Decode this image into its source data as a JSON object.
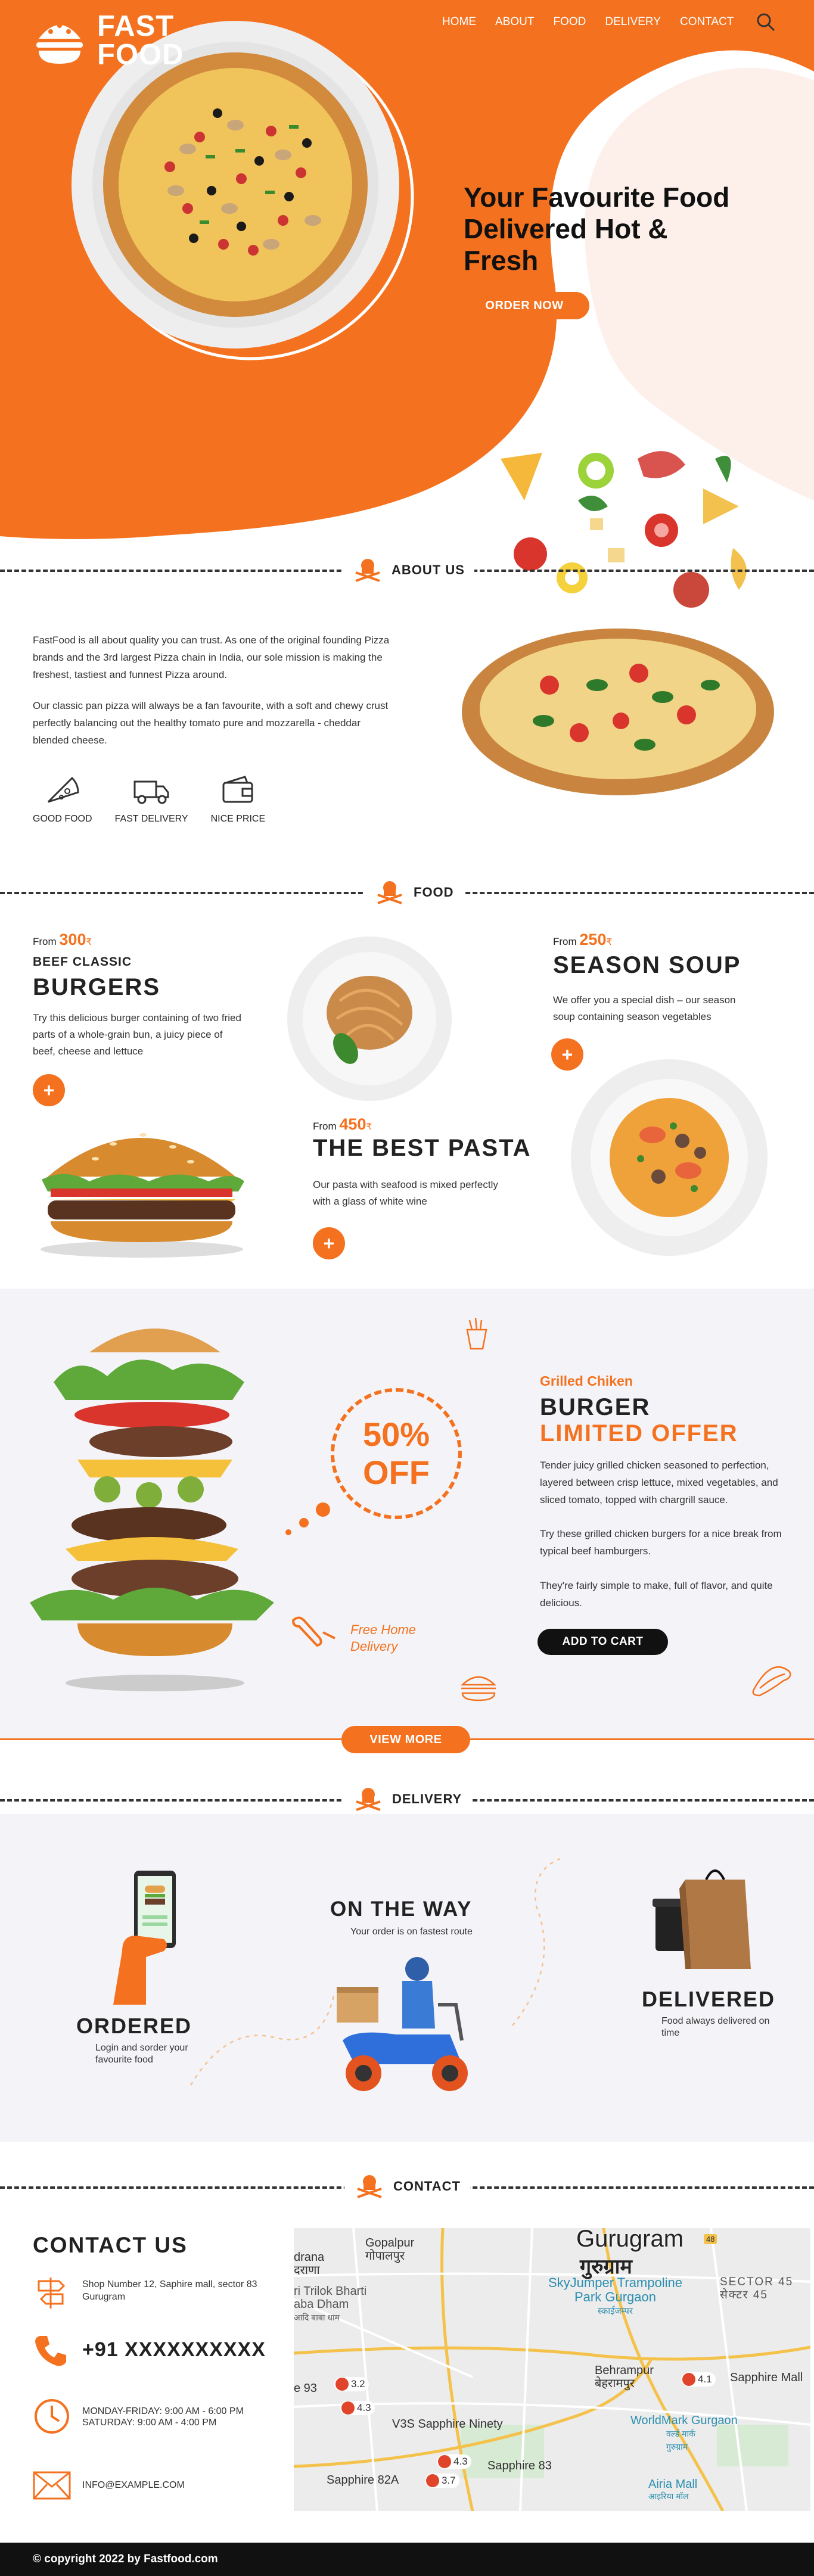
{
  "brand": {
    "line1": "FAST",
    "line2": "FOOD",
    "logo": "pizza-burger-logo-icon"
  },
  "nav": [
    {
      "label": "HOME"
    },
    {
      "label": "ABOUT"
    },
    {
      "label": "FOOD"
    },
    {
      "label": "DELIVERY"
    },
    {
      "label": "CONTACT"
    }
  ],
  "hero": {
    "title1": "Your Favourite Food",
    "title2": "Delivered Hot &",
    "title3": "Fresh",
    "cta": "ORDER NOW"
  },
  "about": {
    "tag": "ABOUT US",
    "p1": "FastFood is all about quality you can trust. As one of the original founding Pizza brands and the 3rd largest Pizza chain in India, our sole mission is making the freshest, tastiest and funnest Pizza around.",
    "p2": "Our classic pan pizza will always be a fan favourite, with a soft and chewy crust perfectly balancing out the healthy tomato pure and mozzarella - cheddar blended cheese.",
    "features": [
      {
        "label": "GOOD FOOD",
        "icon": "pizza-slice-icon"
      },
      {
        "label": "FAST DELIVERY",
        "icon": "truck-icon"
      },
      {
        "label": "NICE PRICE",
        "icon": "wallet-icon"
      }
    ]
  },
  "food": {
    "tag": "FOOD",
    "burgers": {
      "from": "From",
      "price": "300",
      "currency": "₹",
      "sub": "BEEF CLASSIC",
      "title": "BURGERS",
      "desc": "Try this delicious burger containing of two fried parts of a whole-grain bun, a juicy piece of beef, cheese and lettuce"
    },
    "soup": {
      "from": "From",
      "price": "250",
      "currency": "₹",
      "title": "SEASON SOUP",
      "desc": "We offer you a special dish – our season soup containing season vegetables"
    },
    "pasta": {
      "from": "From",
      "price": "450",
      "currency": "₹",
      "title": "THE BEST PASTA",
      "desc": "Our pasta with seafood is mixed perfectly with a glass of white wine"
    }
  },
  "offer": {
    "badge1": "50%",
    "badge2": "OFF",
    "delivery1": "Free Home",
    "delivery2": "Delivery",
    "kicker": "Grilled Chiken",
    "title": "BURGER",
    "subtitle": "LIMITED OFFER",
    "p1": "Tender juicy grilled chicken seasoned to perfection, layered between crisp lettuce, mixed vegetables, and sliced tomato, topped with chargrill sauce.",
    "p2": "Try these grilled chicken burgers for a nice break from typical beef hamburgers.",
    "p3": "They're fairly simple to make, full of flavor, and quite delicious.",
    "cart": "ADD TO CART",
    "more": "VIEW MORE"
  },
  "delivery": {
    "tag": "DELIVERY",
    "ordered": {
      "title": "ORDERED",
      "desc": "Login and sorder your favourite food"
    },
    "way": {
      "title": "ON THE WAY",
      "desc": "Your order is on fastest route"
    },
    "delivered": {
      "title": "DELIVERED",
      "desc": "Food always delivered on time"
    }
  },
  "contact": {
    "tag": "CONTACT",
    "title": "CONTACT US",
    "address": "Shop Number 12, Saphire mall, sector 83 Gurugram",
    "phone": "+91 XXXXXXXXXX",
    "hours1": "MONDAY-FRIDAY: 9:00 AM - 6:00 PM",
    "hours2": "SATURDAY: 9:00 AM - 4:00 PM",
    "email": "INFO@EXAMPLE.COM"
  },
  "map": {
    "labels": {
      "gurugram": "Gurugram",
      "gurugram_hi": "गुरुग्राम",
      "gopalpur": "Gopalpur",
      "gopalpur_hi": "गोपालपुर",
      "drana": "drana",
      "drana_hi": "दराणा",
      "trilok1": "ri Trilok Bharti",
      "trilok2": "aba Dham",
      "trilok3": "आदि बाबा धाम",
      "skyjumper1": "SkyJumper Trampoline",
      "skyjumper2": "Park Gurgaon",
      "skyjumper3": "स्काईजम्पर",
      "sector45": "SECTOR 45",
      "sector45_hi": "सेक्टर 45",
      "behrampur": "Behrampur",
      "behrampur_hi": "बेहरामपुर",
      "sapphire": "Sapphire Mall",
      "worldmark1": "WorldMark Gurgaon",
      "worldmark2": "वर्ल्ड मार्क",
      "worldmark3": "गुरुग्राम",
      "v3s": "V3S Sapphire Ninety",
      "s93": "e 93",
      "sapphire83": "Sapphire 83",
      "sapphire82a": "Sapphire 82A",
      "airia": "Airia Mall",
      "airia_hi": "आइरिया मॉल",
      "road48": "48"
    },
    "pins": [
      "3.2",
      "4.3",
      "4.3",
      "3.7",
      "4.1"
    ]
  },
  "footer": {
    "text": "© copyright 2022 by Fastfood.com"
  },
  "colors": {
    "accent": "#f4721f",
    "dark": "#111111",
    "light": "#f4f4f8"
  }
}
